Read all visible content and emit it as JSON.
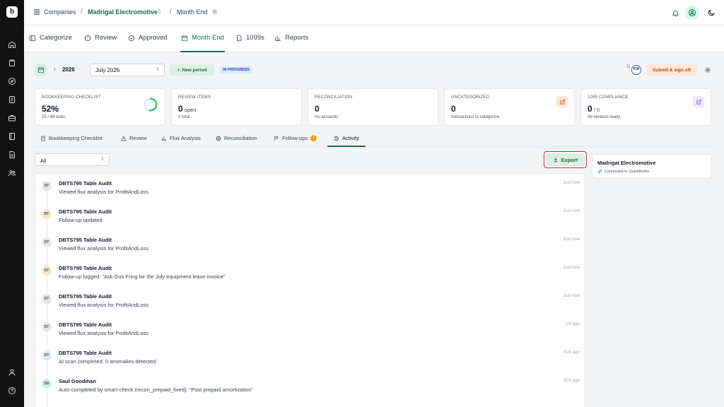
{
  "breadcrumb": {
    "companies": "Companies",
    "company": "Madrigal Electromotive",
    "page": "Month End"
  },
  "nav_tabs": [
    {
      "label": "Categorize",
      "icon": "wallet-icon"
    },
    {
      "label": "Review",
      "icon": "info-icon"
    },
    {
      "label": "Approved",
      "icon": "check-circle-icon"
    },
    {
      "label": "Month End",
      "icon": "calendar-icon",
      "active": true
    },
    {
      "label": "1099s",
      "icon": "document-icon"
    },
    {
      "label": "Reports",
      "icon": "bar-chart-icon"
    }
  ],
  "period": {
    "year": "2026",
    "month": "July 2026",
    "new_period": "New period",
    "status": "IN PROGRESS",
    "reviewer_initials": "D",
    "avatar_initials": "KW",
    "submit": "Submit & sign off"
  },
  "cards": [
    {
      "label": "BOOKKEEPING CHECKLIST",
      "value": "52%",
      "unit": "",
      "sub": "25 / 48 tasks",
      "progress": 0.52
    },
    {
      "label": "REVIEW ITEMS",
      "value": "0",
      "unit": "open",
      "sub": "0 total"
    },
    {
      "label": "RECONCILIATION",
      "value": "0",
      "unit": "",
      "sub": "No accounts"
    },
    {
      "label": "UNCATEGORIZED",
      "value": "0",
      "unit": "",
      "sub": "transactions to categorize"
    },
    {
      "label": "1099 COMPLIANCE",
      "value": "0",
      "unit": "/ 0",
      "sub": "All vendors ready"
    }
  ],
  "sub_tabs": [
    {
      "label": "Bookkeeping Checklist"
    },
    {
      "label": "Review"
    },
    {
      "label": "Flux Analysis"
    },
    {
      "label": "Reconciliation"
    },
    {
      "label": "Follow-ups",
      "badge": "1"
    },
    {
      "label": "Activity",
      "active": true
    }
  ],
  "filter": {
    "value": "All"
  },
  "export_label": "Export",
  "company_card": {
    "name": "Madrigal Electromotive",
    "status": "Connected to QuickBooks"
  },
  "activity": [
    {
      "initials": "DT",
      "user": "DBTS795 Table Audit",
      "desc": "Viewed flux analysis for ProfitAndLoss",
      "time": "Just now",
      "avatar_bg": "#e5e7eb"
    },
    {
      "initials": "DT",
      "user": "DBTS795 Table Audit",
      "desc": "Follow-up updated",
      "time": "Just now",
      "avatar_bg": "#f3e8c8"
    },
    {
      "initials": "DT",
      "user": "DBTS795 Table Audit",
      "desc": "Viewed flux analysis for ProfitAndLoss",
      "time": "Just now",
      "avatar_bg": "#e5e7eb"
    },
    {
      "initials": "DT",
      "user": "DBTS795 Table Audit",
      "desc": "Follow-up logged: \"Ask Gus Fring for the July equipment lease invoice\"",
      "time": "Just now",
      "avatar_bg": "#f3e8c8"
    },
    {
      "initials": "DT",
      "user": "DBTS795 Table Audit",
      "desc": "Viewed flux analysis for ProfitAndLoss",
      "time": "Just now",
      "avatar_bg": "#e5e7eb"
    },
    {
      "initials": "DT",
      "user": "DBTS795 Table Audit",
      "desc": "Viewed flux analysis for ProfitAndLoss",
      "time": "1m ago",
      "avatar_bg": "#e5e7eb"
    },
    {
      "initials": "DT",
      "user": "DBTS795 Table Audit",
      "desc": "AI scan completed: 0 anomalies detected",
      "time": "31m ago",
      "avatar_bg": "#e0e7ff"
    },
    {
      "initials": "SG",
      "user": "Saul Goodman",
      "desc": "Auto-completed by smart-check (recon_prepaid_fixed): \"Post prepaid amortization\"",
      "time": "31m ago",
      "avatar_bg": "#cfe9ec"
    }
  ],
  "colors": {
    "brand_green": "#1a6b4a",
    "sidebar_bg": "#121212",
    "highlight_red": "#dc2626",
    "accent_orange": "#c2410c"
  }
}
